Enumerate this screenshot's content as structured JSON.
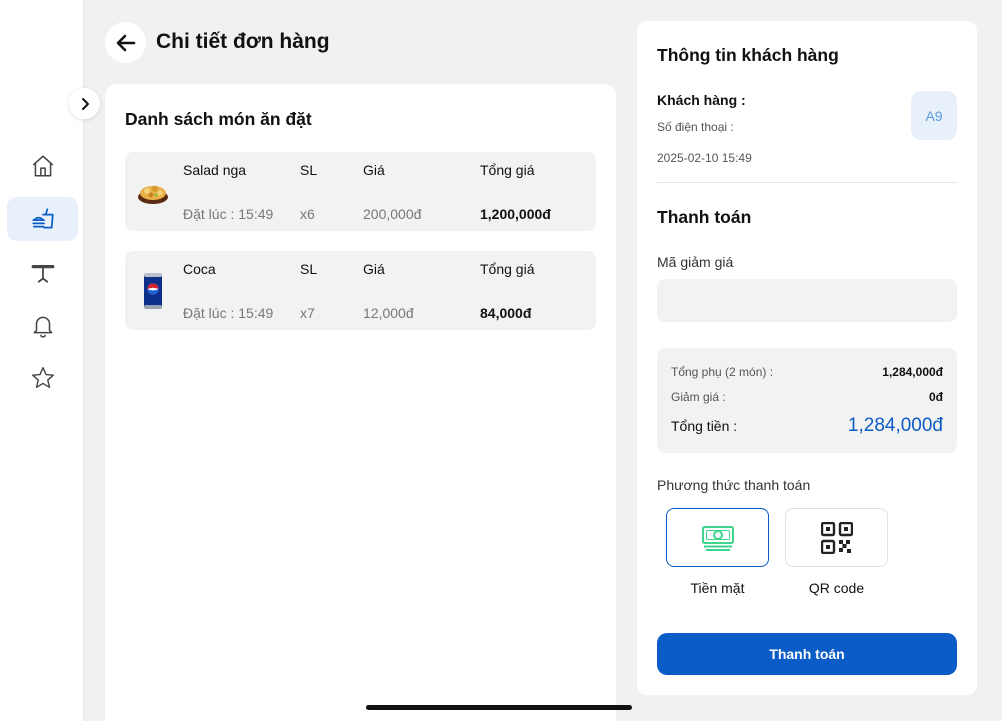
{
  "header": {
    "title": "Chi tiết đơn hàng"
  },
  "sidebar": {
    "items": [
      {
        "icon": "home-icon",
        "active": false
      },
      {
        "icon": "food-order-icon",
        "active": true
      },
      {
        "icon": "table-icon",
        "active": false
      },
      {
        "icon": "bell-icon",
        "active": false
      },
      {
        "icon": "star-icon",
        "active": false
      }
    ]
  },
  "order_list": {
    "heading": "Danh sách món ăn đặt",
    "columns": {
      "qty": "SL",
      "price": "Giá",
      "total": "Tổng giá"
    },
    "items": [
      {
        "name": "Salad nga",
        "ordered_at": "Đặt lúc : 15:49",
        "qty": "x6",
        "price": "200,000đ",
        "total": "1,200,000đ",
        "image": "salad-image"
      },
      {
        "name": "Coca",
        "ordered_at": "Đặt lúc : 15:49",
        "qty": "x7",
        "price": "12,000đ",
        "total": "84,000đ",
        "image": "cola-can-image"
      }
    ]
  },
  "customer": {
    "title": "Thông tin khách hàng",
    "name_label": "Khách hàng :",
    "phone_label": "Số điện thoại :",
    "datetime": "2025-02-10 15:49",
    "table": "A9"
  },
  "payment": {
    "title": "Thanh toán",
    "discount_label": "Mã giảm giá",
    "discount_value": "",
    "subtotal_label": "Tổng phụ (2 món) :",
    "subtotal_value": "1,284,000đ",
    "discount_amount_label": "Giảm giá :",
    "discount_amount_value": "0đ",
    "total_label": "Tổng tiền :",
    "total_value": "1,284,000đ",
    "method_label": "Phương thức thanh toán",
    "methods": [
      {
        "label": "Tiền mặt",
        "icon": "cash-icon",
        "selected": true
      },
      {
        "label": "QR code",
        "icon": "qr-code-icon",
        "selected": false
      }
    ],
    "submit_label": "Thanh toán"
  },
  "colors": {
    "accent": "#0b5cc7",
    "badge_bg": "#e8f1fb",
    "cash_green": "#3dd68c"
  }
}
